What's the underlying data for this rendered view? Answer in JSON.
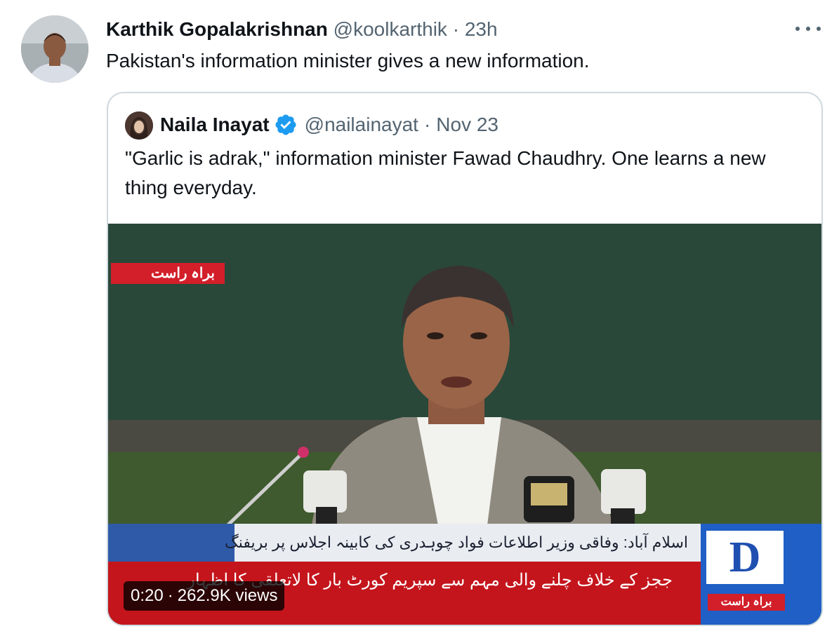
{
  "tweet": {
    "author_name": "Karthik Gopalakrishnan",
    "author_handle": "@koolkarthik",
    "separator": "·",
    "time": "23h",
    "text": "Pakistan's information minister gives a new information."
  },
  "quoted_tweet": {
    "author_name": "Naila Inayat",
    "author_handle": "@nailainayat",
    "separator": "·",
    "date": "Nov 23",
    "text": "\"Garlic is adrak,\" information minister Fawad Chaudhry. One learns a new thing everyday."
  },
  "video": {
    "live_tag": "براہ راست",
    "ticker_top": "اسلام آباد: وفاقی وزیر اطلاعات فواد چوہدری کی کابینہ اجلاس پر بریفنگ",
    "ticker_bottom": "ججز کے خلاف چلنے والی مہم سے سپریم کورٹ بار کا لاتعلقی کا اظہار",
    "logo_letter": "D",
    "logo_subtitle": "براہ راست",
    "duration": "0:20",
    "views": "262.9K views",
    "meta_separator": "·"
  },
  "icons": {
    "more": "more-horizontal-icon",
    "verified": "verified-badge-icon"
  },
  "colors": {
    "verified_blue": "#1d9bf0",
    "muted_text": "#536471",
    "ticker_red": "#c4151c",
    "channel_blue": "#1f5fc6"
  }
}
